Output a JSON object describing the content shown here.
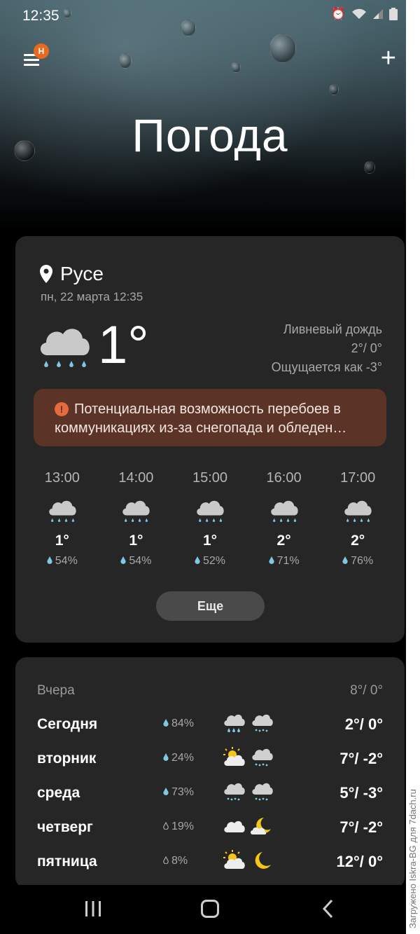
{
  "status_bar": {
    "time": "12:35"
  },
  "header": {
    "menu_badge": "H",
    "add_label": "+",
    "title": "Погода"
  },
  "location": {
    "name": "Русе",
    "datetime": "пн, 22 марта 12:35"
  },
  "current": {
    "temp": "1°",
    "condition": "Ливневый дождь",
    "high_low": "2°/ 0°",
    "feels_like": "Ощущается как -3°",
    "icon": "rain-cloud-icon"
  },
  "alert": {
    "icon": "!",
    "text": "Потенциальная возможность перебоев в коммуникациях из-за снегопада и обледен…"
  },
  "hourly": [
    {
      "time": "13:00",
      "temp": "1°",
      "precip": "54%",
      "icon": "rain-cloud-icon"
    },
    {
      "time": "14:00",
      "temp": "1°",
      "precip": "54%",
      "icon": "rain-cloud-icon"
    },
    {
      "time": "15:00",
      "temp": "1°",
      "precip": "52%",
      "icon": "rain-cloud-icon"
    },
    {
      "time": "16:00",
      "temp": "2°",
      "precip": "71%",
      "icon": "rain-cloud-icon"
    },
    {
      "time": "17:00",
      "temp": "2°",
      "precip": "76%",
      "icon": "rain-cloud-icon"
    }
  ],
  "more_label": "Еще",
  "week": {
    "yesterday": {
      "label": "Вчера",
      "temps": "8°/ 0°"
    },
    "days": [
      {
        "name": "Сегодня",
        "precip": "84%",
        "temps": "2°/ 0°",
        "icon_day": "rain-cloud-icon",
        "icon_night": "snow-cloud-icon"
      },
      {
        "name": "вторник",
        "precip": "24%",
        "temps": "7°/ -2°",
        "icon_day": "sun-cloud-icon",
        "icon_night": "snow-cloud-icon"
      },
      {
        "name": "среда",
        "precip": "73%",
        "temps": "5°/ -3°",
        "icon_day": "snow-cloud-icon",
        "icon_night": "snow-cloud-icon"
      },
      {
        "name": "четверг",
        "precip": "19%",
        "temps": "7°/ -2°",
        "icon_day": "cloud-icon",
        "icon_night": "moon-cloud-icon"
      },
      {
        "name": "пятница",
        "precip": "8%",
        "temps": "12°/ 0°",
        "icon_day": "sun-cloud-icon",
        "icon_night": "moon-icon"
      }
    ]
  },
  "watermark": "Загружено Iskra-BG для 7dach.ru",
  "colors": {
    "card": "#262626",
    "alert": "#5b3327",
    "drop": "#7ec8e3",
    "sun": "#f5c518"
  }
}
